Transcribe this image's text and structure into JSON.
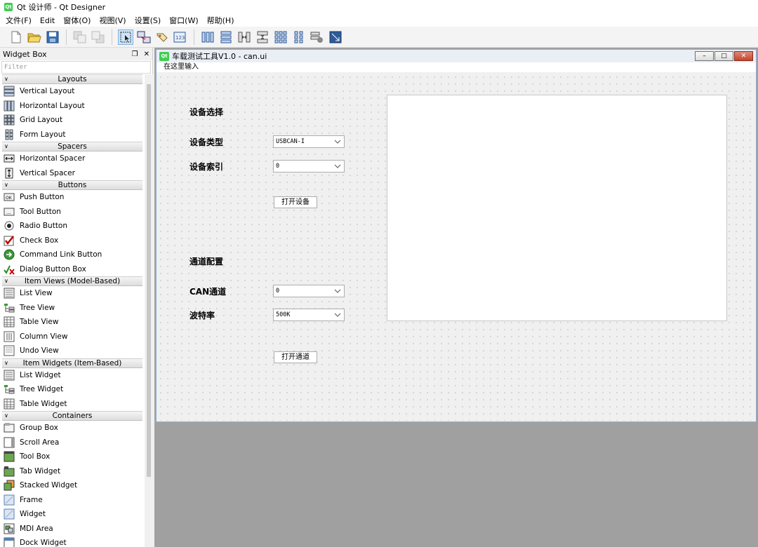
{
  "window": {
    "title": "Qt 设计师 - Qt Designer",
    "logo_text": "Qt"
  },
  "menu": [
    "文件(F)",
    "Edit",
    "窗体(O)",
    "视图(V)",
    "设置(S)",
    "窗口(W)",
    "帮助(H)"
  ],
  "toolbar": {
    "icons": [
      "new-file-icon",
      "open-folder-icon",
      "save-icon",
      "send-to-back-icon",
      "bring-to-front-icon",
      "edit-widgets-icon",
      "edit-signals-slots-icon",
      "edit-buddies-icon",
      "edit-tab-order-icon",
      "layout-horizontal-icon",
      "layout-vertical-icon",
      "layout-horizontal-splitter-icon",
      "layout-vertical-splitter-icon",
      "layout-grid-icon",
      "layout-form-icon",
      "break-layout-icon",
      "adjust-size-icon"
    ]
  },
  "widget_box": {
    "title": "Widget Box",
    "filter_placeholder": "Filter",
    "categories": [
      {
        "name": "Layouts",
        "items": [
          "Vertical Layout",
          "Horizontal Layout",
          "Grid Layout",
          "Form Layout"
        ]
      },
      {
        "name": "Spacers",
        "items": [
          "Horizontal Spacer",
          "Vertical Spacer"
        ]
      },
      {
        "name": "Buttons",
        "items": [
          "Push Button",
          "Tool Button",
          "Radio Button",
          "Check Box",
          "Command Link Button",
          "Dialog Button Box"
        ]
      },
      {
        "name": "Item Views (Model-Based)",
        "items": [
          "List View",
          "Tree View",
          "Table View",
          "Column View",
          "Undo View"
        ]
      },
      {
        "name": "Item Widgets (Item-Based)",
        "items": [
          "List Widget",
          "Tree Widget",
          "Table Widget"
        ]
      },
      {
        "name": "Containers",
        "items": [
          "Group Box",
          "Scroll Area",
          "Tool Box",
          "Tab Widget",
          "Stacked Widget",
          "Frame",
          "Widget",
          "MDI Area",
          "Dock Widget"
        ]
      }
    ]
  },
  "form": {
    "title": "车载测试工具V1.0 - can.ui",
    "menu_placeholder": "在这里输入",
    "device_section": "设备选择",
    "device_type_label": "设备类型",
    "device_type_value": "USBCAN-I",
    "device_index_label": "设备索引",
    "device_index_value": "0",
    "open_device_button": "打开设备",
    "channel_section": "通道配置",
    "can_channel_label": "CAN通道",
    "can_channel_value": "0",
    "baud_rate_label": "波特率",
    "baud_rate_value": "500K",
    "open_channel_button": "打开通道"
  }
}
